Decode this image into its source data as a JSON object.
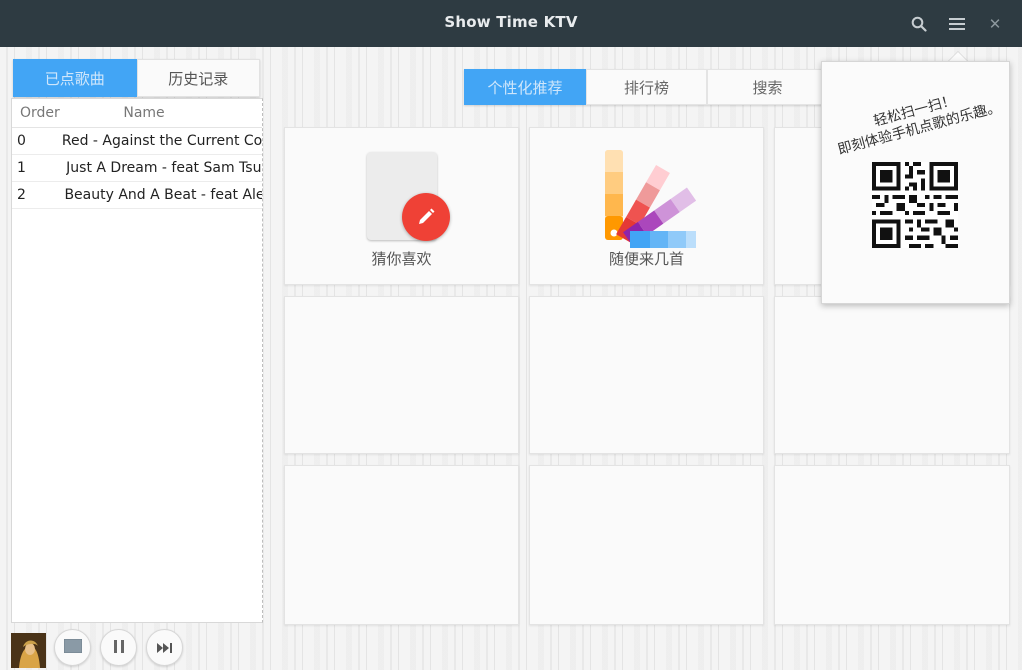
{
  "window": {
    "title": "Show Time KTV"
  },
  "titlebar": {
    "search_icon": "search-icon",
    "menu_icon": "hamburger-menu-icon",
    "close_symbol": "✕"
  },
  "left_tabs": [
    {
      "label": "已点歌曲",
      "active": true
    },
    {
      "label": "历史记录",
      "active": false
    }
  ],
  "playlist": {
    "columns": {
      "order": "Order",
      "name": "Name"
    },
    "rows": [
      {
        "order": "0",
        "name": "Red - Against the Current Cover"
      },
      {
        "order": "1",
        "name": "Just A Dream - feat Sam Tsui"
      },
      {
        "order": "2",
        "name": "Beauty And A Beat - feat Alex"
      }
    ]
  },
  "top_tabs": [
    {
      "label": "个性化推荐",
      "active": true
    },
    {
      "label": "排行榜",
      "active": false
    },
    {
      "label": "搜索",
      "active": false
    }
  ],
  "tiles": {
    "guess": {
      "label": "猜你喜欢",
      "icon": "pencil-icon"
    },
    "random": {
      "label": "随便来几首",
      "icon": "color-palette-icon"
    }
  },
  "qr_popover": {
    "line1": "轻松扫一扫！",
    "line2": "即刻体验手机点歌的乐趣。",
    "qr_icon": "qr-code"
  },
  "colors": {
    "titlebar": "#2e3b42",
    "accent": "#42a5f5",
    "badge_red": "#ef4136"
  }
}
